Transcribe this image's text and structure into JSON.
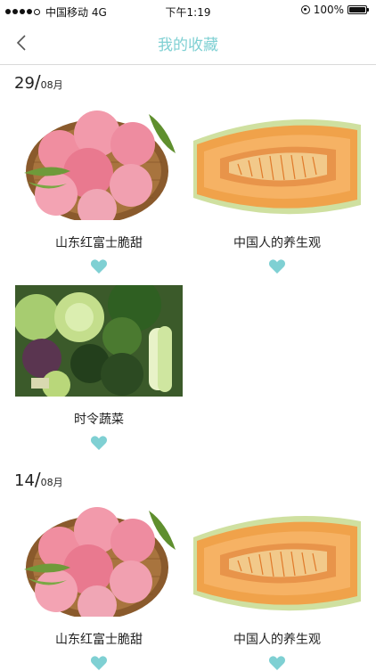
{
  "status_bar": {
    "carrier": "中国移动 4G",
    "time": "下午1:19",
    "battery": "100%"
  },
  "nav": {
    "title": "我的收藏"
  },
  "colors": {
    "accent": "#7fd0d3",
    "heart": "#7fd0d3"
  },
  "sections": [
    {
      "day": "29",
      "month": "08月",
      "items": [
        {
          "title": "山东红富士脆甜",
          "image": "apples-basket"
        },
        {
          "title": "中国人的养生观",
          "image": "cantaloupe-slice"
        },
        {
          "title": "时令蔬菜",
          "image": "vegetables-pile"
        }
      ]
    },
    {
      "day": "14",
      "month": "08月",
      "items": [
        {
          "title": "山东红富士脆甜",
          "image": "apples-basket"
        },
        {
          "title": "中国人的养生观",
          "image": "cantaloupe-slice"
        }
      ]
    }
  ]
}
